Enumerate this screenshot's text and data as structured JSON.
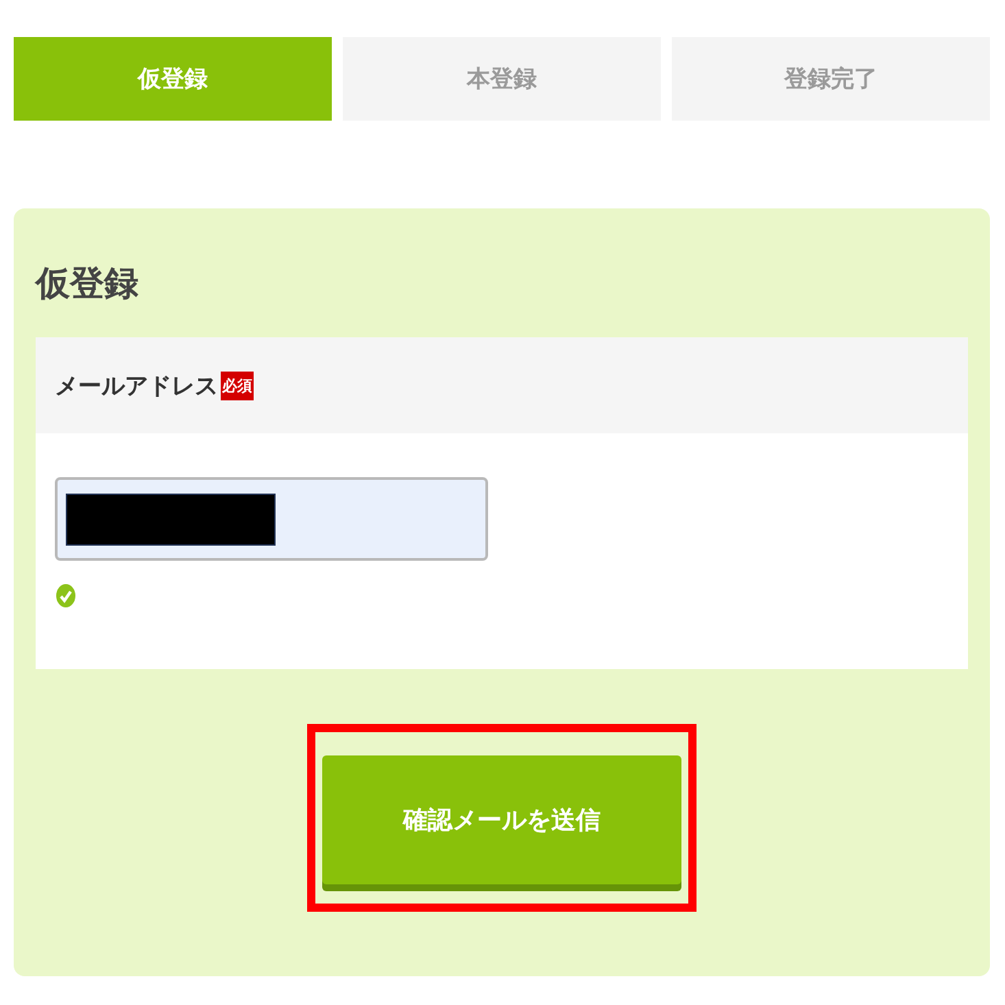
{
  "steps": [
    {
      "label": "仮登録",
      "selected": true
    },
    {
      "label": "本登録",
      "selected": false
    },
    {
      "label": "登録完了",
      "selected": false
    }
  ],
  "form": {
    "title": "仮登録",
    "field": {
      "label": "メールアドレス",
      "required_badge": "必須",
      "redacted": true,
      "valid": true
    },
    "submit": {
      "label": "確認メールを送信",
      "highlighted": true
    }
  }
}
